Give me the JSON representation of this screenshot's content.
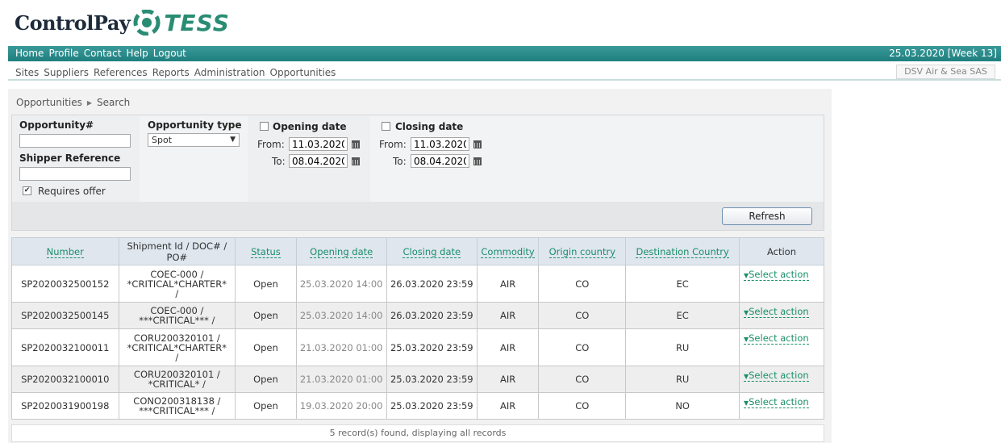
{
  "brand": {
    "name": "ControlPay",
    "partner": "TESS"
  },
  "topnav": {
    "items": [
      "Home",
      "Profile",
      "Contact",
      "Help",
      "Logout"
    ],
    "date": "25.03.2020 [Week 13]"
  },
  "subnav": {
    "items": [
      "Sites",
      "Suppliers",
      "References",
      "Reports",
      "Administration",
      "Opportunities"
    ],
    "company": "DSV Air & Sea SAS"
  },
  "breadcrumb": {
    "root": "Opportunities",
    "current": "Search"
  },
  "filters": {
    "opportunity_label": "Opportunity#",
    "opportunity_value": "",
    "shipper_label": "Shipper Reference",
    "shipper_value": "",
    "requires_offer_label": "Requires offer",
    "requires_offer_checked": true,
    "type_label": "Opportunity type",
    "type_value": "Spot",
    "opening": {
      "label": "Opening date",
      "from_label": "From:",
      "to_label": "To:",
      "from": "11.03.2020",
      "to": "08.04.2020"
    },
    "closing": {
      "label": "Closing date",
      "from_label": "From:",
      "to_label": "To:",
      "from": "11.03.2020",
      "to": "08.04.2020"
    },
    "refresh_label": "Refresh"
  },
  "table": {
    "headers": [
      "Number",
      "Shipment Id / DOC# / PO#",
      "Status",
      "Opening date",
      "Closing date",
      "Commodity",
      "Origin country",
      "Destination Country",
      "Action"
    ],
    "action_label": "Select action",
    "rows": [
      {
        "number": "SP2020032500152",
        "ship": [
          "COEC-000 /",
          "*CRITICAL*CHARTER*",
          "/"
        ],
        "status": "Open",
        "opening": "25.03.2020 14:00",
        "closing": "26.03.2020 23:59",
        "commodity": "AIR",
        "origin": "CO",
        "dest": "EC"
      },
      {
        "number": "SP2020032500145",
        "ship": [
          "COEC-000 /",
          "***CRITICAL*** /"
        ],
        "status": "Open",
        "opening": "25.03.2020 14:00",
        "closing": "26.03.2020 23:59",
        "commodity": "AIR",
        "origin": "CO",
        "dest": "EC"
      },
      {
        "number": "SP2020032100011",
        "ship": [
          "CORU200320101 /",
          "*CRITICAL*CHARTER*",
          "/"
        ],
        "status": "Open",
        "opening": "21.03.2020 01:00",
        "closing": "25.03.2020 23:59",
        "commodity": "AIR",
        "origin": "CO",
        "dest": "RU"
      },
      {
        "number": "SP2020032100010",
        "ship": [
          "CORU200320101 /",
          "*CRITICAL* /"
        ],
        "status": "Open",
        "opening": "21.03.2020 01:00",
        "closing": "25.03.2020 23:59",
        "commodity": "AIR",
        "origin": "CO",
        "dest": "RU"
      },
      {
        "number": "SP2020031900198",
        "ship": [
          "CONO200318138 /",
          "***CRITICAL*** /"
        ],
        "status": "Open",
        "opening": "19.03.2020 20:00",
        "closing": "25.03.2020 23:59",
        "commodity": "AIR",
        "origin": "CO",
        "dest": "NO"
      }
    ]
  },
  "footer": {
    "status": "5 record(s) found, displaying all records"
  },
  "colors": {
    "nav_bg": "#1f7f7f",
    "link_green": "#1a8f6a",
    "brand_teal": "#2a8c73"
  }
}
